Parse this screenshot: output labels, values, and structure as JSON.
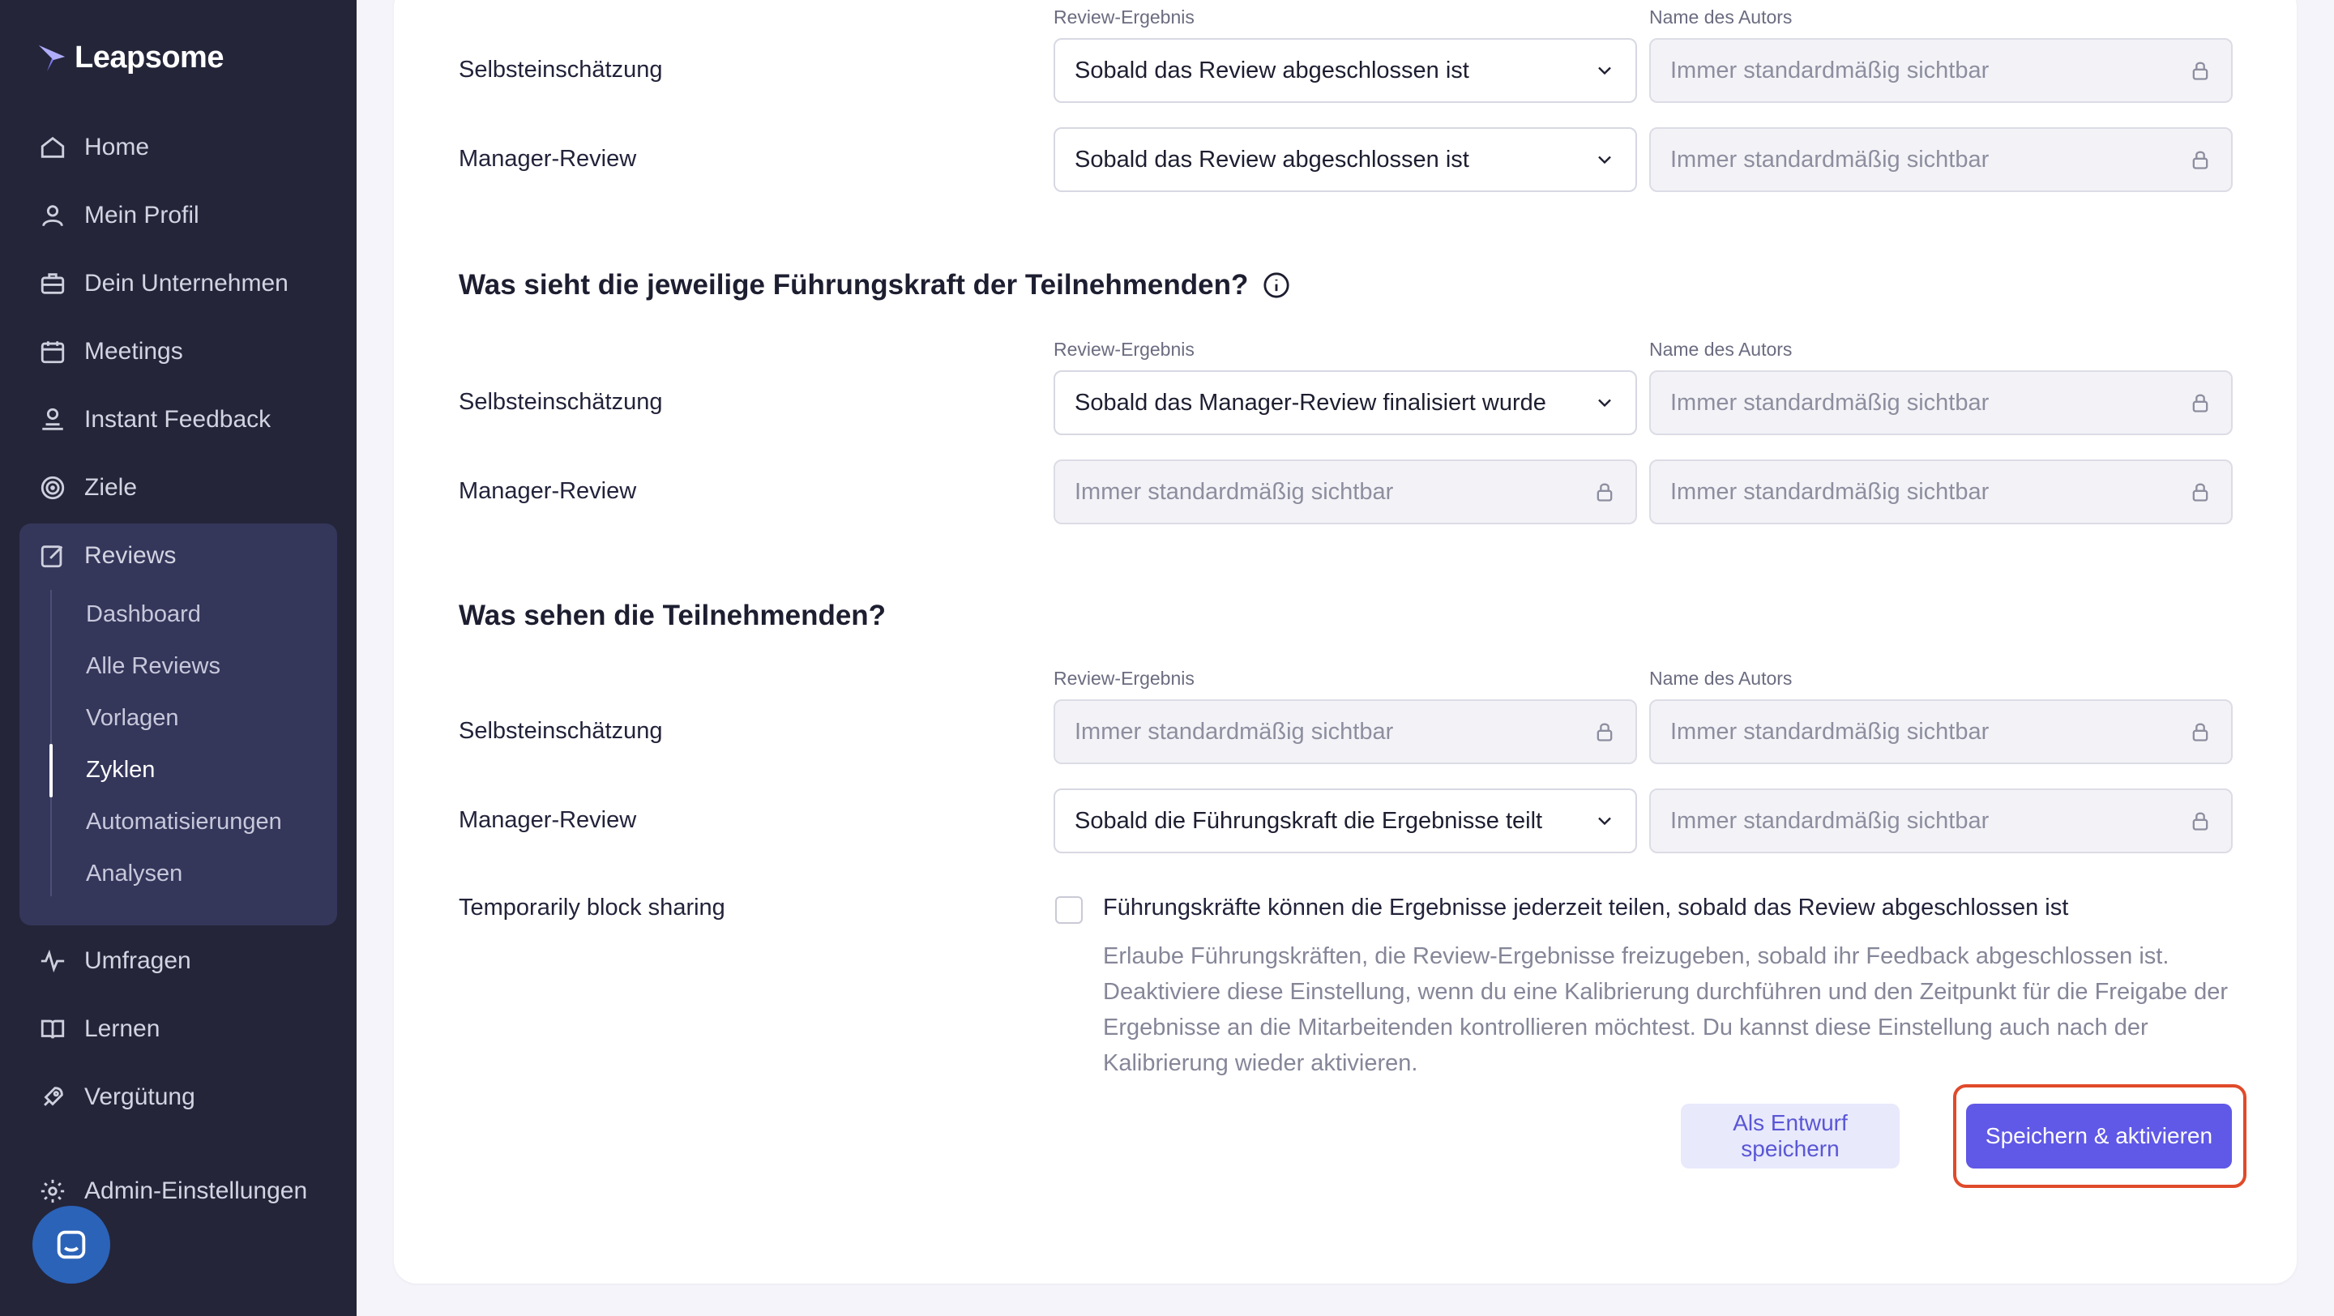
{
  "sidebar": {
    "brand": "Leapsome",
    "nav": [
      {
        "label": "Home",
        "icon": "home-icon"
      },
      {
        "label": "Mein Profil",
        "icon": "user-icon"
      },
      {
        "label": "Dein Unternehmen",
        "icon": "briefcase-icon"
      },
      {
        "label": "Meetings",
        "icon": "calendar-icon"
      },
      {
        "label": "Instant Feedback",
        "icon": "feedback-icon"
      },
      {
        "label": "Ziele",
        "icon": "target-icon"
      },
      {
        "label": "Reviews",
        "icon": "edit-icon"
      },
      {
        "label": "Umfragen",
        "icon": "pulse-icon"
      },
      {
        "label": "Lernen",
        "icon": "book-icon"
      },
      {
        "label": "Vergütung",
        "icon": "rocket-icon"
      },
      {
        "label": "Admin-Einstellungen",
        "icon": "gear-icon"
      }
    ],
    "reviews_sub": [
      "Dashboard",
      "Alle Reviews",
      "Vorlagen",
      "Zyklen",
      "Automatisierungen",
      "Analysen"
    ],
    "active_sub": "Zyklen"
  },
  "colheads": {
    "result": "Review-Ergebnis",
    "author": "Name des Autors"
  },
  "sections": [
    {
      "title": "",
      "rows": [
        {
          "label": "Selbsteinschätzung",
          "result": "Sobald das Review abgeschlossen ist",
          "result_type": "select",
          "author": "Immer standardmäßig sichtbar",
          "author_type": "locked"
        },
        {
          "label": "Manager-Review",
          "result": "Sobald das Review abgeschlossen ist",
          "result_type": "select",
          "author": "Immer standardmäßig sichtbar",
          "author_type": "locked"
        }
      ]
    },
    {
      "title": "Was sieht die jeweilige Führungskraft der Teilnehmenden?",
      "rows": [
        {
          "label": "Selbsteinschätzung",
          "result": "Sobald das Manager-Review finalisiert wurde",
          "result_type": "select",
          "author": "Immer standardmäßig sichtbar",
          "author_type": "locked"
        },
        {
          "label": "Manager-Review",
          "result": "Immer standardmäßig sichtbar",
          "result_type": "locked",
          "author": "Immer standardmäßig sichtbar",
          "author_type": "locked"
        }
      ]
    },
    {
      "title": "Was sehen die Teilnehmenden?",
      "rows": [
        {
          "label": "Selbsteinschätzung",
          "result": "Immer standardmäßig sichtbar",
          "result_type": "locked",
          "author": "Immer standardmäßig sichtbar",
          "author_type": "locked"
        },
        {
          "label": "Manager-Review",
          "result": "Sobald die Führungskraft die Ergebnisse teilt",
          "result_type": "select",
          "author": "Immer standardmäßig sichtbar",
          "author_type": "locked"
        }
      ]
    }
  ],
  "block_sharing": {
    "label": "Temporarily block sharing",
    "checked": false,
    "checkbox_label": "Führungskräfte können die Ergebnisse jederzeit teilen, sobald das Review abgeschlossen ist",
    "description": "Erlaube Führungskräften, die Review-Ergebnisse freizugeben, sobald ihr Feedback abgeschlossen ist. Deaktiviere diese Einstellung, wenn du eine Kalibrierung durchführen und den Zeitpunkt für die Freigabe der Ergebnisse an die Mitarbeitenden kontrollieren möchtest. Du kannst diese Einstellung auch nach der Kalibrierung wieder aktivieren."
  },
  "buttons": {
    "draft": "Als Entwurf speichern",
    "activate": "Speichern & aktivieren"
  },
  "colors": {
    "sidebar": "#242539",
    "accent": "#6058e6",
    "highlight": "#e04a2a"
  }
}
